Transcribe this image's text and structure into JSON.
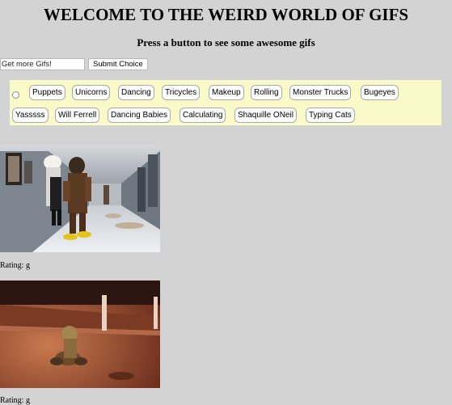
{
  "header": {
    "title": "WELCOME TO THE WEIRD WORLD OF GIFS",
    "subtitle": "Press a button to see some awesome gifs"
  },
  "search": {
    "placeholder": "Get more Gifs!",
    "value": "",
    "submit_label": "Submit Choice"
  },
  "topics": [
    "Puppets",
    "Unicorns",
    "Dancing",
    "Tricycles",
    "Makeup",
    "Rolling",
    "Monster Trucks",
    "Bugeyes",
    "Yasssss",
    "Will Ferrell",
    "Dancing Babies",
    "Calculating",
    "Shaquille ONeil",
    "Typing Cats"
  ],
  "results": [
    {
      "rating_label": "Rating: g",
      "image_alt": "people in costumes dancing in a hallway"
    },
    {
      "rating_label": "Rating: g",
      "image_alt": "dog rolling on a street at night"
    }
  ],
  "colors": {
    "page_background": "#d3d3d3",
    "button_panel_background": "#fafac8"
  }
}
